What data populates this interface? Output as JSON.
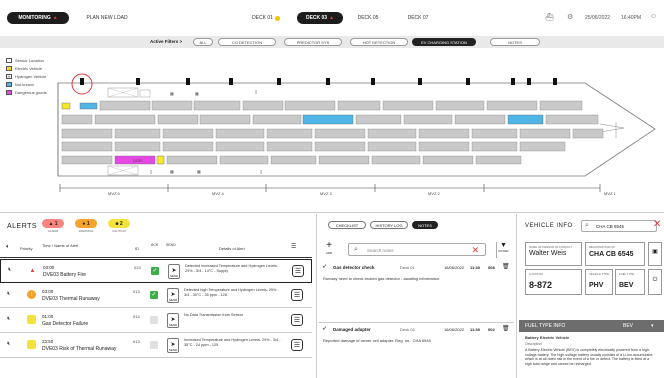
{
  "nav": {
    "monitoring": "MONITORING",
    "plan_new_load": "PLAN NEW LOAD",
    "decks": [
      "DECK 01",
      "DECK 03",
      "DECK 05",
      "DECK 07"
    ],
    "date": "25/06/2022",
    "time": "16:40PM"
  },
  "filters": {
    "label": "Active Filters >",
    "chips": [
      "ALL",
      "CO DETECTION",
      "PREDICTOR SYS",
      "HOT DETECTION",
      "EV CHARGING STATION",
      "NOTES"
    ]
  },
  "legend": [
    "Sensor Location",
    "Electric Vehicle",
    "Hydrogen Vehicle",
    "Not known",
    "Dangerous goods"
  ],
  "deck": {
    "zones": [
      "MVZ 5",
      "MVZ 4",
      "MVZ 3",
      "MVZ 2",
      "MVZ 1"
    ],
    "markers": [
      "EV",
      "DGR"
    ]
  },
  "alerts": {
    "title": "ALERTS",
    "counts": [
      {
        "value": "1",
        "label": "ALARM",
        "color": "#f7857d",
        "icon": "warning-icon"
      },
      {
        "value": "1",
        "label": "WARNING",
        "color": "#f5a32a",
        "icon": "alert-circle-icon"
      },
      {
        "value": "2",
        "label": "CAUTION",
        "color": "#f5e23a",
        "icon": "caution-icon"
      }
    ],
    "cols": {
      "priority": "Priority",
      "time_name": "Time / Name of Alert",
      "id": "ID",
      "ack": "ACK",
      "send": "SEND",
      "details": "Details of Alert",
      "details_btn": "DETAILS"
    },
    "rows": [
      {
        "time": "03:00",
        "name": "DVE03 Battery Fire",
        "id": "013",
        "detail": "Detected increased Temperature and Hydrogen Levels. 29% - 3/4 - 14°C - Supply",
        "prio": "alarm",
        "ack": true,
        "selected": true
      },
      {
        "time": "03:00",
        "name": "DVE03 Thermal Runaway",
        "id": "013",
        "detail": "Detected high Temperature and Hydrogen Levels. 29% - 3/4 - 30°C - 35 ppm - 128",
        "prio": "warning",
        "ack": true,
        "selected": false
      },
      {
        "time": "01:00",
        "name": "Gas Detector Failure",
        "id": "014",
        "detail": "No Data Transmission from Sensor",
        "prio": "caution",
        "ack": false,
        "selected": false
      },
      {
        "time": "23:50",
        "name": "DVE03 Risk of Thermal Runaway",
        "id": "013",
        "detail": "Increased Temperature and Hydrogen Levels. 29% - 3/4 - 35°C - 24 ppm - 125",
        "prio": "caution",
        "ack": false,
        "selected": false
      }
    ]
  },
  "notes": {
    "tabs": [
      "CHECKLIST",
      "HISTORY LOG",
      "NOTES"
    ],
    "add_label": "ADD",
    "search_placeholder": "Search notes",
    "filter_label": "FILTER",
    "items": [
      {
        "title": "Gas detector check",
        "deck": "Deck 01",
        "date": "18/06/2022",
        "time": "11:30",
        "count": "008",
        "body": "Runway need to check broken gas detector - awaiting information."
      },
      {
        "title": "Damaged adapter",
        "deck": "Deck 03",
        "date": "16/06/2022",
        "time": "11:30",
        "count": "002",
        "body": "Reported damage of owner cell adapter. Reg. no.: CHA 6545"
      }
    ]
  },
  "vehicle": {
    "title": "VEHICLE INFO",
    "search_value": "CHA CB 6545",
    "contact_cap": "NAME OF PERSON IN CONTACT",
    "contact": "Walter Weis",
    "reg_cap": "REGISTRATION NO.",
    "reg": "CHA CB 6545",
    "loc_cap": "LOCATION",
    "loc": "8-872",
    "type_cap": "VEHICLE TYPE",
    "type": "PHV",
    "fuel_cap": "FUEL TYPE",
    "fuel": "BEV",
    "fuel_info_title": "FUEL TYPE INFO",
    "fuel_info_select": "BEV",
    "bev_title": "Battery Electric Vehicle",
    "bev_sub": "Description",
    "bev_text": "A Battery Electric Vehicle (BEV) is completely electrically powered from a high-voltage battery. The high-voltage battery usually consists of a Li-ion accumulator, which is at all-rated risk in the event of a fire or defect. The battery is fixed at a high total range and cannot be recharged."
  }
}
